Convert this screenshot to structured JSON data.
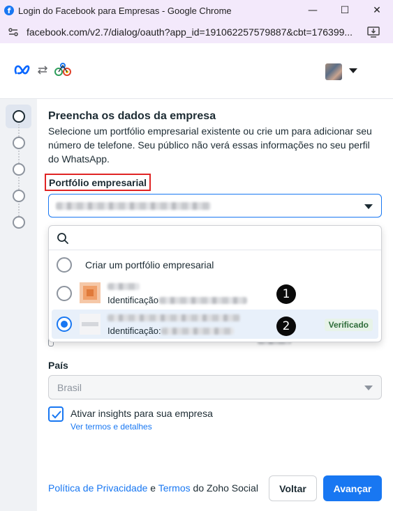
{
  "window": {
    "title": "Login do Facebook para Empresas - Google Chrome",
    "url": "facebook.com/v2.7/dialog/oauth?app_id=191062257579887&cbt=176399...",
    "controls": {
      "minimize": "—",
      "maximize": "☐",
      "close": "✕"
    }
  },
  "header": {
    "avatar_icon": "user-avatar"
  },
  "stepper": {
    "steps": 5,
    "active_step": 1
  },
  "form": {
    "title": "Preencha os dados da empresa",
    "description": "Selecione um portfólio empresarial existente ou crie um para adicionar seu número de telefone. Seu público não verá essas informações no seu perfil do WhatsApp.",
    "portfolio_label": "Portfólio empresarial",
    "dropdown": {
      "create_option": "Criar um portfólio empresarial",
      "items": [
        {
          "id_label": "Identificação",
          "selected": false,
          "marker": "1",
          "verified": false
        },
        {
          "id_label": "Identificação:",
          "selected": true,
          "marker": "2",
          "verified": true,
          "badge": "Verificado"
        }
      ]
    },
    "country_label": "País",
    "country_value": "Brasil",
    "insights_label": "Ativar insights para sua empresa",
    "insights_checked": true,
    "terms_link": "Ver termos e detalhes"
  },
  "footer": {
    "privacy_link": "Política de Privacidade",
    "and_text": " e ",
    "terms_link": "Termos",
    "suffix": " do Zoho Social",
    "back_button": "Voltar",
    "next_button": "Avançar"
  },
  "colors": {
    "accent": "#1877f2",
    "highlight": "#e02424",
    "verified_bg": "#e7f3e8"
  }
}
